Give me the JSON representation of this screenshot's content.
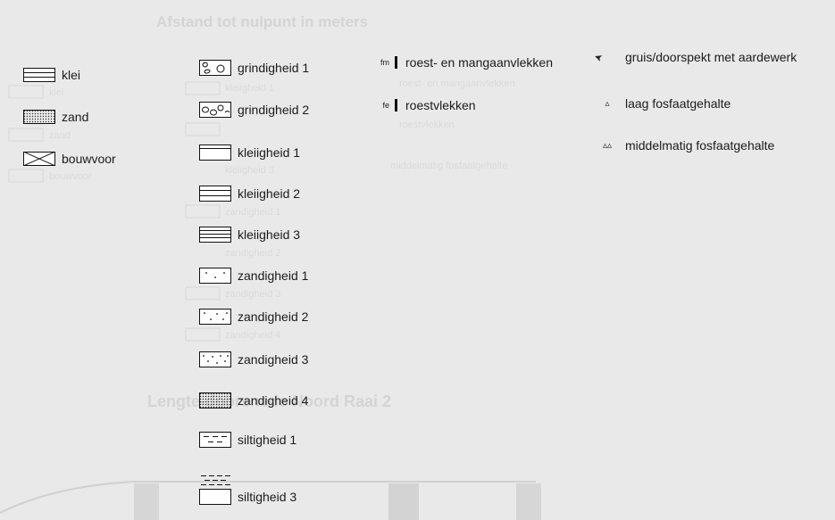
{
  "legend_left": [
    {
      "label": "klei",
      "icon": "klei-pattern-icon"
    },
    {
      "label": "zand",
      "icon": "zand-pattern-icon"
    },
    {
      "label": "bouwvoor",
      "icon": "bouwvoor-pattern-icon"
    }
  ],
  "legend_middle": [
    {
      "label": "grindigheid 1",
      "icon": "grindigheid-1-icon"
    },
    {
      "label": "grindigheid 2",
      "icon": "grindigheid-2-icon"
    },
    {
      "label": "kleiigheid 1",
      "icon": "kleiigheid-1-icon"
    },
    {
      "label": "kleiigheid 2",
      "icon": "kleiigheid-2-icon"
    },
    {
      "label": "kleiigheid 3",
      "icon": "kleiigheid-3-icon"
    },
    {
      "label": "zandigheid 1",
      "icon": "zandigheid-1-icon"
    },
    {
      "label": "zandigheid 2",
      "icon": "zandigheid-2-icon"
    },
    {
      "label": "zandigheid 3",
      "icon": "zandigheid-3-icon"
    },
    {
      "label": "zandigheid 4",
      "icon": "zandigheid-4-icon"
    },
    {
      "label": "siltigheid 1",
      "icon": "siltigheid-1-icon"
    },
    {
      "label": "siltigheid 3",
      "icon": "siltigheid-3-icon"
    }
  ],
  "legend_vlekken": [
    {
      "abbr": "fm",
      "label": "roest- en mangaanvlekken"
    },
    {
      "abbr": "fe",
      "label": "roestvlekken"
    }
  ],
  "legend_right": [
    {
      "symbol": "➤",
      "label": "gruis/doorspekt met aardewerk",
      "icon": "gruis-arrow-icon"
    },
    {
      "symbol": "▵",
      "label": "laag fosfaatgehalte",
      "icon": "triangle-small-icon"
    },
    {
      "symbol": "▵▵",
      "label": "middelmatig fosfaatgehalte",
      "icon": "triangle-double-icon"
    }
  ],
  "bleed_through": {
    "top_heading": "Afstand tot nulpunt in meters",
    "mid_heading": "Lengte-doorsnede Noord Raai 2",
    "left_labels": [
      "klei",
      "zand",
      "bouwvoor"
    ],
    "middle_labels": [
      "kleiigheid 1",
      "kleiigheid 3",
      "zandigheid 1",
      "zandigheid 2",
      "zandigheid 3",
      "zandigheid 4"
    ],
    "right_labels": [
      "roest- en mangaanvlekken",
      "roestvlekken",
      "middelmatig fosfaatgehalte"
    ]
  },
  "colors": {
    "background": "#e9e9e9",
    "ink": "#1b1b1b",
    "ghost": "#d4d4d4"
  }
}
